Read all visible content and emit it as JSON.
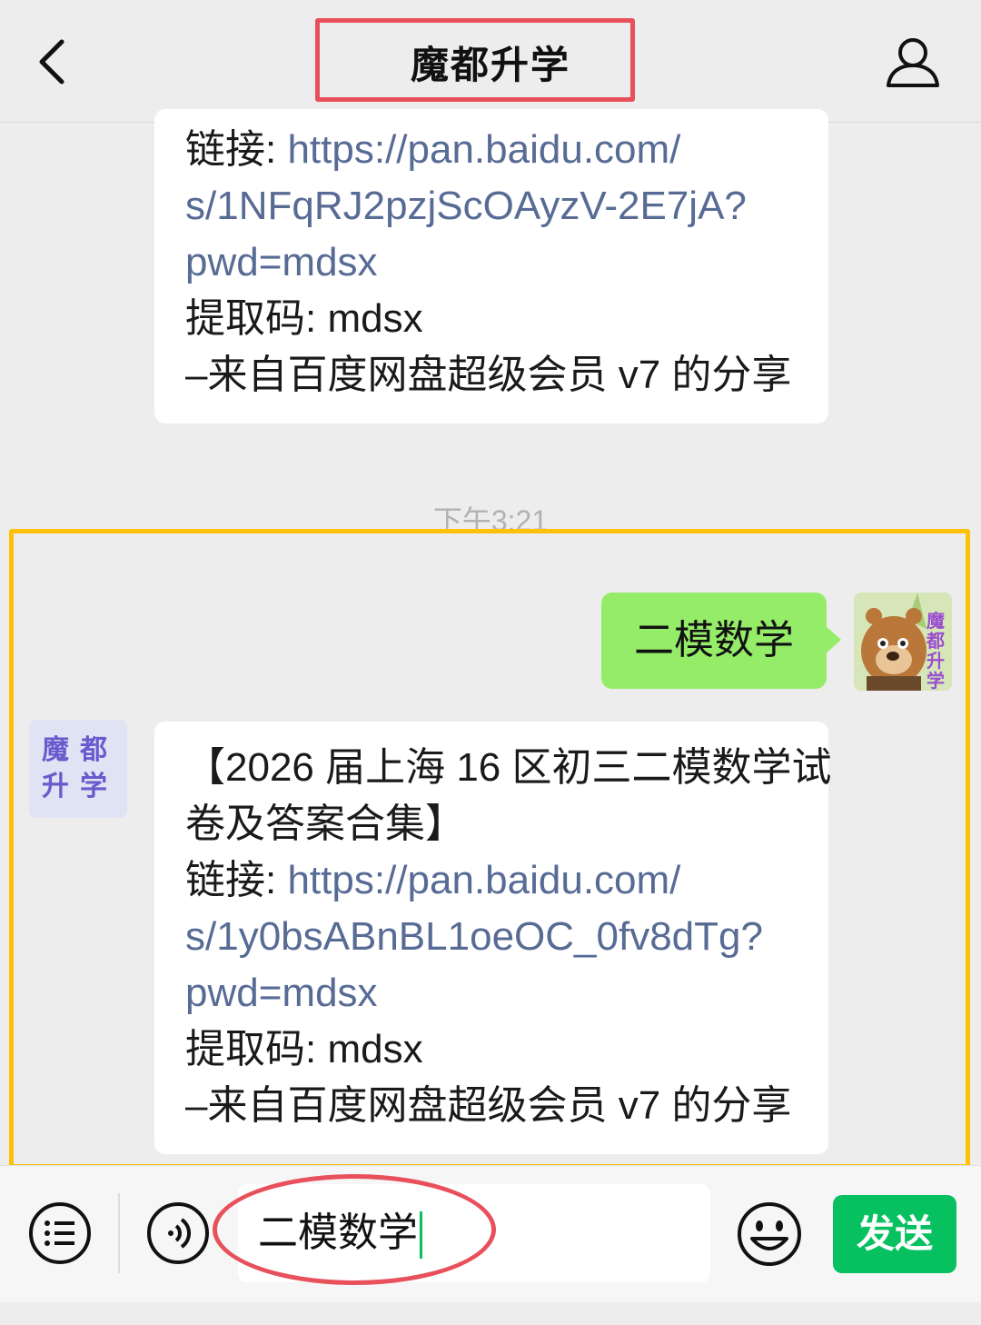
{
  "header": {
    "title": "魔都升学"
  },
  "messages": {
    "top": {
      "link_label": "链接: ",
      "link_line1": "https://pan.baidu.com/",
      "link_line2": "s/1NFqRJ2pzjScOAyzV-2E7jA?",
      "link_line3": "pwd=mdsx",
      "code": "提取码: mdsx",
      "footer": "–来自百度网盘超级会员 v7 的分享"
    },
    "timestamp": "下午3:21",
    "sent": {
      "text": "二模数学"
    },
    "reply": {
      "title_line1": "【2026 届上海 16 区初三二模数学试",
      "title_line2": "卷及答案合集】",
      "link_label": "链接: ",
      "link_line1": "https://pan.baidu.com/",
      "link_line2": "s/1y0bsABnBL1oeOC_0fv8dTg?",
      "link_line3": "pwd=mdsx",
      "code": "提取码: mdsx",
      "footer": "–来自百度网盘超级会员 v7 的分享"
    }
  },
  "avatars": {
    "self_brand": [
      "魔",
      "都",
      "升",
      "学"
    ],
    "bot_brand": [
      "魔",
      "都",
      "升",
      "学"
    ]
  },
  "input": {
    "value": "二模数学",
    "send_label": "发送"
  },
  "colors": {
    "sent_bubble": "#95ec69",
    "link": "#576b95",
    "send_button": "#07c160",
    "title_highlight": "#e8505b",
    "selection_highlight": "#ffc107"
  },
  "icons": [
    "back-arrow-icon",
    "profile-icon",
    "menu-list-icon",
    "voice-icon",
    "emoji-icon"
  ]
}
